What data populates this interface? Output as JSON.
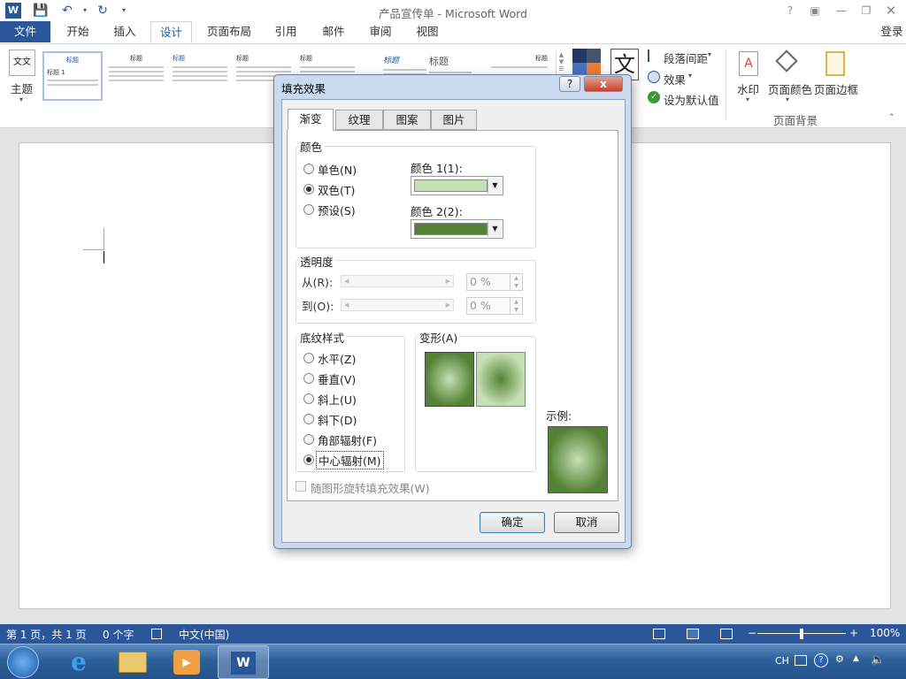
{
  "window": {
    "title": "产品宣传单 - Microsoft Word",
    "help": "?",
    "login": "登录"
  },
  "tabs": [
    {
      "label": "文件"
    },
    {
      "label": "开始"
    },
    {
      "label": "插入"
    },
    {
      "label": "设计"
    },
    {
      "label": "页面布局"
    },
    {
      "label": "引用"
    },
    {
      "label": "邮件"
    },
    {
      "label": "审阅"
    },
    {
      "label": "视图"
    }
  ],
  "ribbon": {
    "theme_label": "主题",
    "theme_icon_text": "文文",
    "thumb_titles": [
      "标题",
      "标题",
      "标题",
      "标题",
      "标题",
      "标题",
      "标题",
      "标题",
      "标题"
    ],
    "thumb_heading": "标题 1",
    "big_text_icon": "文",
    "paragraph_spacing": "段落间距",
    "effects": "效果",
    "set_default": "设为默认值",
    "watermark": "水印",
    "page_color": "页面颜色",
    "page_borders": "页面边框",
    "page_background_group": "页面背景"
  },
  "dialog": {
    "title": "填充效果",
    "help": "?",
    "close": "x",
    "tabs": [
      {
        "label": "渐变"
      },
      {
        "label": "纹理"
      },
      {
        "label": "图案"
      },
      {
        "label": "图片"
      }
    ],
    "colors_group": "颜色",
    "color_options": [
      {
        "label": "单色(N)",
        "checked": false
      },
      {
        "label": "双色(T)",
        "checked": true
      },
      {
        "label": "预设(S)",
        "checked": false
      }
    ],
    "color1_label": "颜色 1(1):",
    "color1_value": "#c6e0b4",
    "color2_label": "颜色 2(2):",
    "color2_value": "#548235",
    "transparency_group": "透明度",
    "from_label": "从(R):",
    "from_value": "0 %",
    "to_label": "到(O):",
    "to_value": "0 %",
    "shading_group": "底纹样式",
    "shading_options": [
      {
        "label": "水平(Z)",
        "checked": false
      },
      {
        "label": "垂直(V)",
        "checked": false
      },
      {
        "label": "斜上(U)",
        "checked": false
      },
      {
        "label": "斜下(D)",
        "checked": false
      },
      {
        "label": "角部辐射(F)",
        "checked": false
      },
      {
        "label": "中心辐射(M)",
        "checked": true
      }
    ],
    "variants_label": "变形(A)",
    "sample_label": "示例:",
    "rotate_label": "随图形旋转填充效果(W)",
    "ok": "确定",
    "cancel": "取消"
  },
  "status": {
    "page": "第 1 页，共 1 页",
    "words": "0 个字",
    "language": "中文(中国)",
    "zoom": "100%",
    "zoom_minus": "−",
    "zoom_plus": "+"
  },
  "taskbar": {
    "tray_lang": "CH"
  }
}
